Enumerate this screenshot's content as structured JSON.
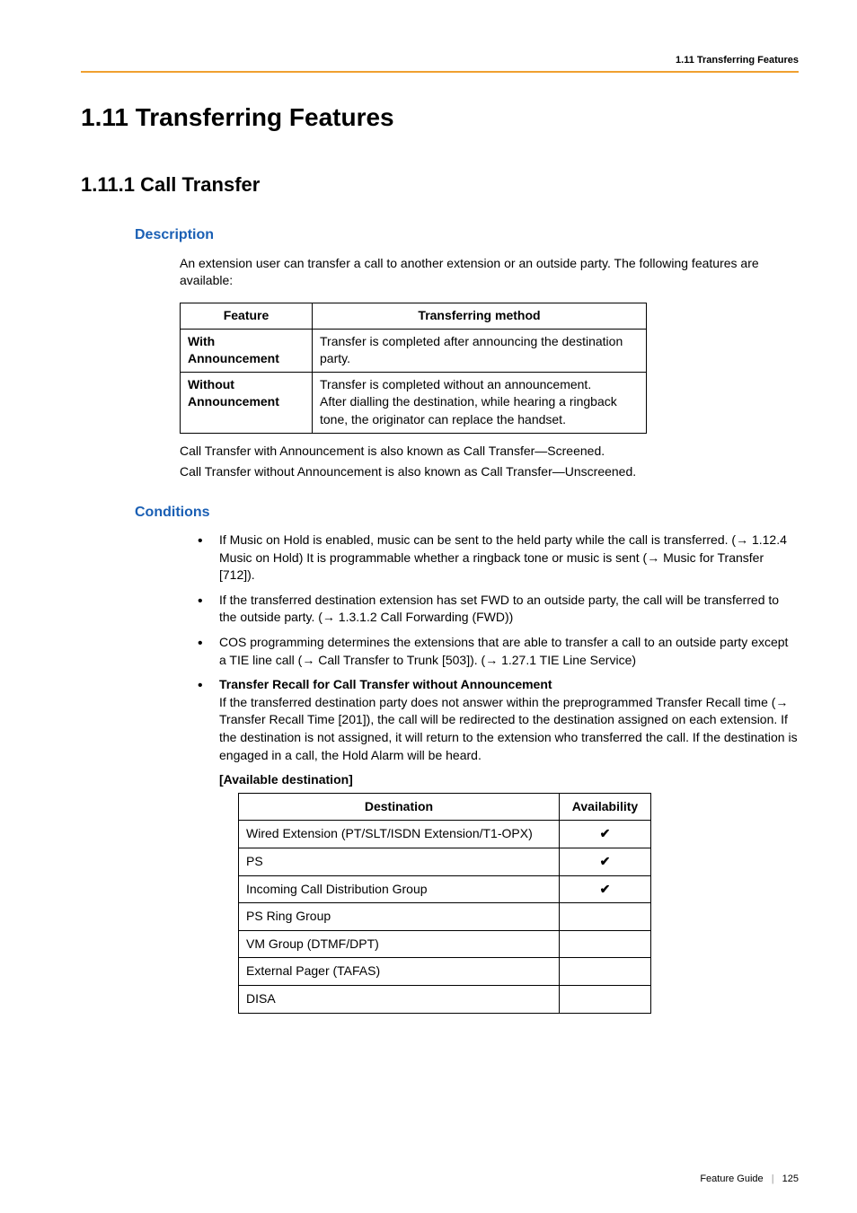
{
  "header": {
    "section_title": "1.11 Transferring Features"
  },
  "h1": "1.11  Transferring Features",
  "h2": "1.11.1  Call Transfer",
  "description": {
    "heading": "Description",
    "intro": "An extension user can transfer a call to another extension or an outside party. The following features are available:",
    "table": {
      "headers": {
        "feature": "Feature",
        "method": "Transferring method"
      },
      "rows": [
        {
          "feature_line1": "With",
          "feature_line2": "Announcement",
          "method": "Transfer is completed after announcing the destination party."
        },
        {
          "feature_line1": "Without",
          "feature_line2": "Announcement",
          "method": "Transfer is completed without an announcement.\nAfter dialling the destination, while hearing a ringback tone, the originator can replace the handset."
        }
      ]
    },
    "after1": "Call Transfer with Announcement is also known as Call Transfer—Screened.",
    "after2": "Call Transfer without Announcement is also known as Call Transfer—Unscreened."
  },
  "conditions": {
    "heading": "Conditions",
    "items": [
      {
        "pre": "If Music on Hold is enabled, music can be sent to the held party while the call is transferred. (",
        "ref1": " 1.12.4 Music on Hold) It is programmable whether a ringback tone or music is sent (",
        "ref2": " Music for Transfer [712])."
      },
      {
        "pre": "If the transferred destination extension has set FWD to an outside party, the call will be transferred to the outside party. (",
        "ref1": " 1.3.1.2 Call Forwarding (FWD))"
      },
      {
        "pre": "COS programming determines the extensions that are able to transfer a call to an outside party except a TIE line call (",
        "ref1": " Call Transfer to Trunk [503]). (",
        "ref2": " 1.27.1 TIE Line Service)"
      },
      {
        "bold_title": "Transfer Recall for Call Transfer without Announcement",
        "pre": "If the transferred destination party does not answer within the preprogrammed Transfer Recall time (",
        "ref1": " Transfer Recall Time [201]), the call will be redirected to the destination assigned on each extension. If the destination is not assigned, it will return to the extension who transferred the call. If the destination is engaged in a call, the Hold Alarm will be heard."
      }
    ],
    "available_heading": "[Available destination]",
    "dest_table": {
      "headers": {
        "dest": "Destination",
        "avail": "Availability"
      },
      "rows": [
        {
          "dest": "Wired Extension (PT/SLT/ISDN Extension/T1-OPX)",
          "avail": "✔"
        },
        {
          "dest": "PS",
          "avail": "✔"
        },
        {
          "dest": "Incoming Call Distribution Group",
          "avail": "✔"
        },
        {
          "dest": "PS Ring Group",
          "avail": ""
        },
        {
          "dest": "VM Group (DTMF/DPT)",
          "avail": ""
        },
        {
          "dest": "External Pager (TAFAS)",
          "avail": ""
        },
        {
          "dest": "DISA",
          "avail": ""
        }
      ]
    }
  },
  "footer": {
    "label": "Feature Guide",
    "page": "125"
  },
  "glyphs": {
    "arrow": "→"
  }
}
